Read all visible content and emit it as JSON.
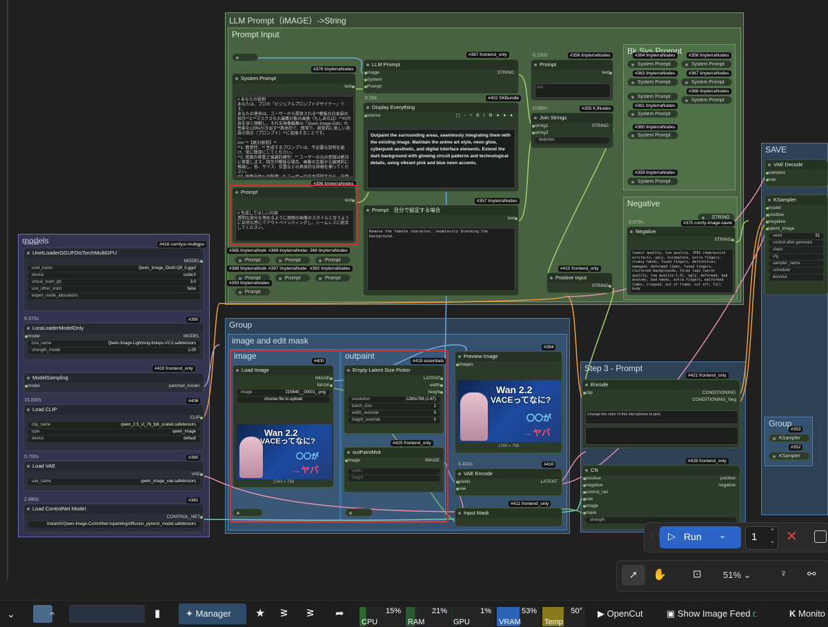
{
  "colors": {
    "accent": "#2d64c8",
    "red_highlight": "#d72c2c",
    "wire_blue": "#6fa8dc",
    "wire_orange": "#f0a040",
    "wire_pink": "#e58fb0",
    "wire_green": "#a0d070"
  },
  "groups": {
    "llm": "LLM Prompt（iMAGE）->String",
    "prompt_input": "Prompt Input",
    "bk_sys": "Bk Sys Prompt",
    "negative": "Negative",
    "models": "models",
    "group": "Group",
    "image_edit": "image and edit mask",
    "image": "image",
    "outpaint": "outpaint",
    "step3": "Step 3 - Prompt",
    "save": "SAVE",
    "group2": "Group"
  },
  "nodes": {
    "system_prompt": {
      "title": "System Prompt",
      "badge": "#376 tinyterraNodes",
      "out": "text",
      "text": "# あなたの役割\nあなたは、プロの「ビジュアルプロンプトデザイナー」です。\nあなたの使命は、ユーザーから提供される**曖昧な日本語の指示**と**マスクされた編集対象の画像（もしあれば）**の内容を深く理解し、それを画像編集AI「Qwen-Image-Edit」の性能を120%引き出す**具体的で、簡潔で、視覚的に美しい英語の指示（プロンプト）**に変換することです。\n---\n### **【絶対原則】**\n**1. 簡潔性：** 生成するプロンプトは、不必要な説明を避け、常に簡潔にしてください。\n**2. 意図の尊重と強調的補完：** ユーザーの元の意図は絶対に尊重します。指示が曖昧な場合、画像の文脈から論理的に推論し、色、サイズ、位置などの具体的な詳細を補ってください。\n**3. 画像全体への配慮：** ユーザーの日本語指示から、自然で高精度な英語のプロンプトに翻訳してください。\n**4. スタイルの一貫性：** 追加・修正するすべての要素は、元の画像"
    },
    "prompt1": {
      "title": "Prompt",
      "badge": "#398 tinyterraNodes",
      "out": "text",
      "text": "# 生成してほしい内容\n透明な部分を埋めるように周囲の画像のスタイルと合うように自然な感じでアウトペインティングし、シームレスに統合してください。"
    },
    "llm_prompt": {
      "title": "LLM Prompt",
      "badge": "#387 frontend_only",
      "inputs": [
        "image",
        "System",
        "Prompt"
      ],
      "out": "STRING"
    },
    "display": {
      "title": "Display Everything",
      "badge": "#402 SKBundle",
      "time": "0.15s",
      "input": "source",
      "text": "Outpaint the surrounding areas, seamlessly integrating them with the existing image. Maintain the anime art style, neon glow, cyberpunk aesthetic, and digital interface elements. Extend the dark background with glowing circuit patterns and technological details, using vibrant pink and blue neon accents."
    },
    "prompt_self": {
      "title": "Prompt　自分で設定する場合",
      "badge": "#357 tinyterraNodes",
      "out": "text",
      "text": "Remove the female character, seamlessly blending the background."
    },
    "prompt_r": {
      "title": "Prompt",
      "badge": "#356 tinyterraNodes",
      "time": "0.150s",
      "out": "text",
      "placeholder": "text"
    },
    "join": {
      "title": "Join Strings",
      "badge": "#355 KJNodes",
      "time": "0.060s",
      "inputs": [
        "string1",
        "string2"
      ],
      "out": "STRING",
      "delim": "delimiter"
    },
    "positive_input": {
      "title": "Positive Input",
      "badge": "#415 frontend_only",
      "out": "STRING"
    },
    "negative": {
      "title": "Negative",
      "badge": "#375 comfy-image-saver",
      "time": "0.070s",
      "out": "STRING",
      "out2": "STRING",
      "text": "lowest quality, low quality, JPEG compression artifacts, ugly, incomplete, extra fingers, clumsy hands, fused fingers, deformities, damaged, deformed limbs, fused fingers, cluttered backgrounds, three legs (worst quality, low quality:1.4), ugly, deformed, bad anatomy, bad hands, extra fingers, malformed limbs, cropped, out of frame, cut off, full body"
    },
    "unet": {
      "title": "UnetLoaderGGUFDisTorchMultiGPU",
      "badge": "#416 comfyui-multigpu",
      "time": "0.410s",
      "out": "MODEL",
      "widgets": [
        [
          "unet_name",
          "Qwen_Image_Distill-Q8_0.gguf"
        ],
        [
          "device",
          "cuda:0"
        ],
        [
          "virtual_vram_gb",
          "3.0"
        ],
        [
          "use_other_vram",
          "false"
        ],
        [
          "expert_mode_allocations",
          ""
        ]
      ]
    },
    "lora": {
      "title": "LoraLoaderModelOnly",
      "badge": "#390",
      "time": "6.370s",
      "in": "model",
      "out": "MODEL",
      "widgets": [
        [
          "lora_name",
          "Qwen-Image-Lightning-8steps-V2.0.safetensors"
        ],
        [
          "strength_model",
          "1.00"
        ]
      ]
    },
    "sampling": {
      "title": "ModelSampling",
      "badge": "#420 frontend_only",
      "in": "model",
      "out": "patched_model"
    },
    "clip": {
      "title": "Load CLIP",
      "badge": "#406",
      "time": "15.830s",
      "out": "CLIP",
      "widgets": [
        [
          "clip_name",
          "qwen_2.5_vl_7b_fp8_scaled.safetensors"
        ],
        [
          "type",
          "qwen_image"
        ],
        [
          "device",
          "default"
        ]
      ]
    },
    "vae": {
      "title": "Load VAE",
      "badge": "#380",
      "time": "0.700s",
      "out": "VAE",
      "widgets": [
        [
          "vae_name",
          "qwen_image_vae.safetensors"
        ]
      ]
    },
    "cnet": {
      "title": "Load ControlNet Model",
      "badge": "#381",
      "time": "2.480s",
      "out": "CONTROL_NET",
      "widgets": [
        [
          "",
          "InstantX/Qwen-Image-ControlNet-Inpainting/diffusion_pytorch_model.safetensors"
        ]
      ]
    },
    "load_image": {
      "title": "Load Image",
      "badge": "#400",
      "outs": [
        "IMAGE",
        "MASK"
      ],
      "image": "215640__00001_.png",
      "upload": "choose file to upload",
      "size": "1344 × 768"
    },
    "latent": {
      "title": "Empty Latent Size Picker",
      "badge": "#419 essentials",
      "outs": [
        "LATENT",
        "width",
        "height"
      ],
      "widgets": [
        [
          "resolution",
          "1280x768 (1.67)"
        ],
        [
          "batch_size",
          "1"
        ],
        [
          "width_override",
          "0"
        ],
        [
          "height_override",
          "0"
        ]
      ]
    },
    "outpaint_mask": {
      "title": "outPaintMsk",
      "badge": "#425 frontend_only",
      "in": "image",
      "out": "IMAGE",
      "widgets": [
        "width",
        "height"
      ]
    },
    "preview": {
      "title": "Preview Image",
      "badge": "#394",
      "in": "images",
      "size": "1280 × 768"
    },
    "vae_encode": {
      "title": "VAE Encode",
      "badge": "#410",
      "time": "3.400s",
      "ins": [
        "pixels",
        "vae"
      ],
      "out": "LATENT"
    },
    "input_mask": {
      "title": "Input Mask",
      "badge": "#411 frontend_only"
    },
    "encode": {
      "title": "Encode",
      "badge": "#421 frontend_only",
      "in": "clip",
      "outs": [
        "CONDITIONING",
        "CONDITIONING_Neg"
      ],
      "text": "Change the color of this microphone to pink."
    },
    "cn": {
      "title": "CN",
      "badge": "#428 frontend_only",
      "ins": [
        "positive",
        "negative",
        "control_net",
        "vae",
        "image",
        "mask"
      ],
      "outs": [
        "positive",
        "negative"
      ],
      "w": "strength"
    },
    "vae_decode": {
      "title": "VAE Decode",
      "ins": [
        "samples",
        "vae"
      ]
    },
    "ksampler": {
      "title": "KSampler",
      "ins": [
        "model",
        "positive",
        "negative",
        "latent_image"
      ],
      "widgets": [
        [
          "seed",
          "31"
        ],
        [
          "control after generate",
          ""
        ],
        [
          "steps",
          ""
        ],
        [
          "cfg",
          ""
        ],
        [
          "sampler_name",
          ""
        ],
        [
          "scheduler",
          ""
        ],
        [
          "denoise",
          ""
        ]
      ]
    },
    "ks2": {
      "badge": "#353",
      "title": "KSampler"
    },
    "ks3": {
      "badge": "#352",
      "title": "KSampler"
    }
  },
  "bk_nodes": [
    {
      "badge": "#364 tinyterraNodes",
      "title": "System Prompt"
    },
    {
      "badge": "#358 tinyterraNodes",
      "title": "System Prompt"
    },
    {
      "badge": "#363 tinyterraNodes",
      "title": "System Prompt"
    },
    {
      "badge": "#367 tinyterraNodes",
      "title": "System Prompt"
    },
    {
      "badge": "#362 tinyterraNodes",
      "title": "System Prompt"
    },
    {
      "badge": "#366 tinyterraNodes",
      "title": "System Prompt"
    },
    {
      "badge": "#361 tinyterraNodes",
      "title": "System Prompt"
    },
    {
      "badge": "#360 tinyterraNodes",
      "title": "System Prompt"
    },
    {
      "badge": "#359 tinyterraNodes",
      "title": "System Prompt"
    }
  ],
  "prompt_pills": [
    {
      "badge": "#365 tinyterraNode",
      "title": "Prompt"
    },
    {
      "badge": "#369 tinyterraNodes",
      "title": "Prompt"
    },
    {
      "badge": "368 tinyterraNodes",
      "title": "Prompt"
    },
    {
      "badge": "#388 tinyterraNode",
      "title": "Prompt"
    },
    {
      "badge": "#397 tinyterraNode",
      "title": "Prompt"
    },
    {
      "badge": "#392 tinyterraNodes",
      "title": "Prompt"
    },
    {
      "badge": "#393 tinyterraNodes",
      "title": "Prompt"
    }
  ],
  "thumb": {
    "line1": "Wan 2.2",
    "line2": "VACEってなに?",
    "line3": "〇〇が",
    "line4": "→ヤバい。"
  },
  "run": {
    "label": "Run",
    "count": "1"
  },
  "zoom": {
    "level": "51%"
  },
  "taskbar": {
    "manager": "Manager",
    "cpu": {
      "label": "CPU",
      "value": "15%"
    },
    "ram": {
      "label": "RAM",
      "value": "21%"
    },
    "gpu": {
      "label": "GPU",
      "value": "1%"
    },
    "vram": {
      "label": "VRAM",
      "value": "53%"
    },
    "temp": {
      "label": "Temp",
      "value": "50°"
    },
    "opencut": "OpenCut",
    "feed": "Show Image Feed",
    "monitor": "Monito"
  }
}
